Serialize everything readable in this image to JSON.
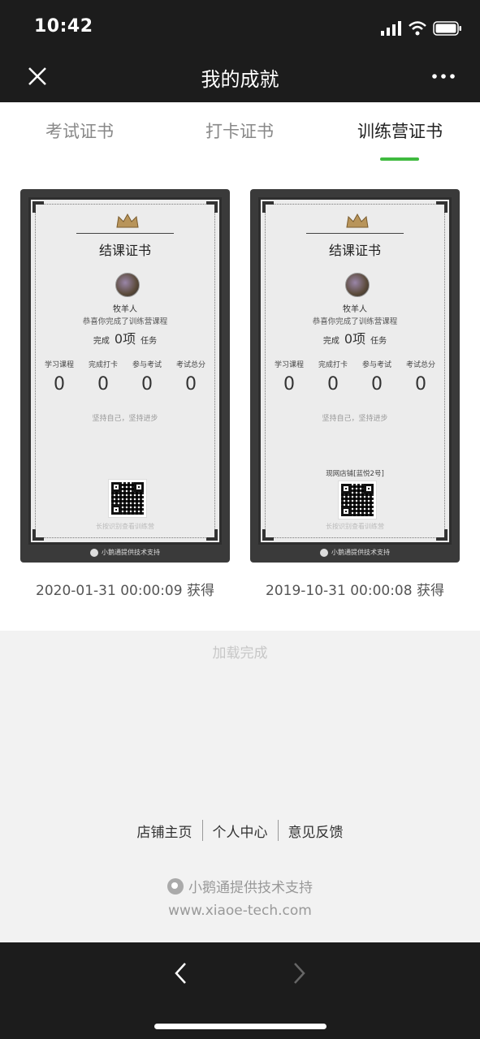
{
  "status_bar": {
    "time": "10:42"
  },
  "nav": {
    "title": "我的成就"
  },
  "tabs": [
    {
      "label": "考试证书",
      "active": false
    },
    {
      "label": "打卡证书",
      "active": false
    },
    {
      "label": "训练营证书",
      "active": true
    }
  ],
  "certificates": [
    {
      "title": "结课证书",
      "name": "牧羊人",
      "congrats": "恭喜你完成了训练营课程",
      "complete_prefix": "完成",
      "complete_count": "0项",
      "complete_suffix": "任务",
      "stats": [
        {
          "label": "学习课程",
          "value": "0"
        },
        {
          "label": "完成打卡",
          "value": "0"
        },
        {
          "label": "参与考试",
          "value": "0"
        },
        {
          "label": "考试总分",
          "value": "0"
        }
      ],
      "motto": "坚持自己，坚持进步",
      "shop": "",
      "hint": "长按识别查看训练营",
      "footer": "小鹅通提供技术支持",
      "date": "2020-01-31 00:00:09 获得"
    },
    {
      "title": "结课证书",
      "name": "牧羊人",
      "congrats": "恭喜你完成了训练营课程",
      "complete_prefix": "完成",
      "complete_count": "0项",
      "complete_suffix": "任务",
      "stats": [
        {
          "label": "学习课程",
          "value": "0"
        },
        {
          "label": "完成打卡",
          "value": "0"
        },
        {
          "label": "参与考试",
          "value": "0"
        },
        {
          "label": "考试总分",
          "value": "0"
        }
      ],
      "motto": "坚持自己，坚持进步",
      "shop": "现网店铺[蓝悦2号]",
      "hint": "长按识别查看训练营",
      "footer": "小鹅通提供技术支持",
      "date": "2019-10-31 00:00:08 获得"
    }
  ],
  "load_status": "加载完成",
  "footer_links": [
    "店铺主页",
    "个人中心",
    "意见反馈"
  ],
  "powered_by": "小鹅通提供技术支持",
  "site": "www.xiaoe-tech.com",
  "colors": {
    "accent": "#3fba3f",
    "bar": "#1c1c1c"
  }
}
